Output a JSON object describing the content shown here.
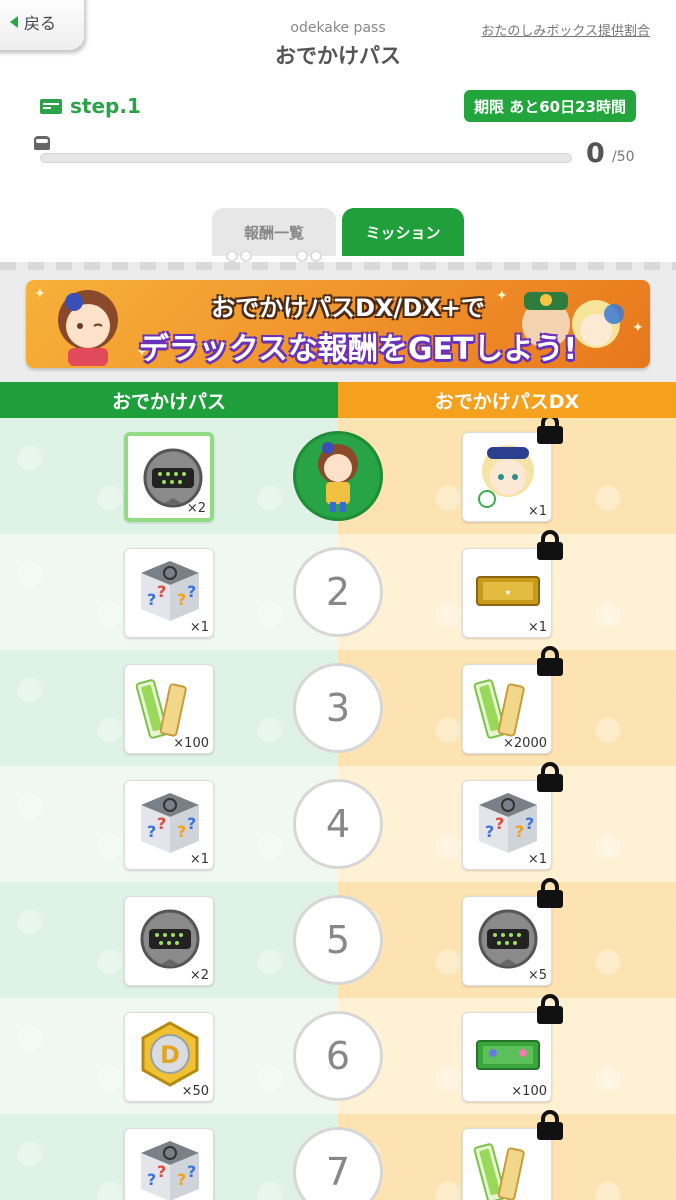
{
  "header": {
    "back_label": "戻る",
    "subtitle": "odekake pass",
    "title": "おでかけパス",
    "ratio_link": "おたのしみボックス提供割合"
  },
  "step": {
    "label": "step.1"
  },
  "deadline": "期限 あと60日23時間",
  "progress": {
    "current": "0",
    "total": "/50",
    "fraction": 0
  },
  "tabs": [
    {
      "label": "報酬一覧",
      "active": false
    },
    {
      "label": "ミッション",
      "active": true
    }
  ],
  "banner": {
    "line1": "おでかけパスDX/DX+で",
    "line2": "デラックスな報酬をGETしよう!"
  },
  "columns": {
    "free": "おでかけパス",
    "dx": "おでかけパスDX"
  },
  "rewards": [
    {
      "level": "1",
      "level_is_avatar": true,
      "free_icon": "orb-device-icon",
      "free_qty": "×2",
      "free_claimed": true,
      "dx_icon": "character-portrait-icon",
      "dx_qty": "×1",
      "dx_locked": true
    },
    {
      "level": "2",
      "free_icon": "mystery-box-icon",
      "free_qty": "×1",
      "dx_icon": "premium-gacha-ticket-icon",
      "dx_qty": "×1",
      "dx_locked": true
    },
    {
      "level": "3",
      "free_icon": "stamina-stick-icon",
      "free_qty": "×100",
      "dx_icon": "stamina-stick-icon",
      "dx_qty": "×2000",
      "dx_locked": true
    },
    {
      "level": "4",
      "free_icon": "mystery-box-icon",
      "free_qty": "×1",
      "dx_icon": "mystery-box-icon",
      "dx_qty": "×1",
      "dx_locked": true
    },
    {
      "level": "5",
      "free_icon": "orb-device-icon",
      "free_qty": "×2",
      "dx_icon": "orb-device-icon",
      "dx_qty": "×5",
      "dx_locked": true
    },
    {
      "level": "6",
      "free_icon": "d-medal-icon",
      "free_qty": "×50",
      "dx_icon": "friend-gacha-ticket-icon",
      "dx_qty": "×100",
      "dx_locked": true
    },
    {
      "level": "7",
      "free_icon": "mystery-box-icon",
      "free_qty": "",
      "dx_icon": "stamina-stick-icon",
      "dx_qty": "",
      "dx_locked": true
    }
  ],
  "colors": {
    "green": "#1e9f3c",
    "orange": "#f6a11e",
    "banner_purple": "#6a31b9"
  }
}
